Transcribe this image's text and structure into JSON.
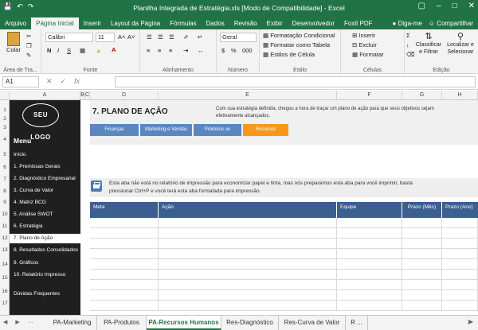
{
  "window": {
    "title": "Planilha Integrada de Estratégia.xls [Modo de Compatibilidade] - Excel",
    "qat_icons": [
      "save-icon",
      "undo-icon",
      "redo-icon"
    ]
  },
  "ribbon_tabs": [
    "Arquivo",
    "Página Inicial",
    "Inserir",
    "Layout da Página",
    "Fórmulas",
    "Dados",
    "Revisão",
    "Exibir",
    "Desenvolvedor",
    "Foxit PDF"
  ],
  "ribbon_right": {
    "tell_me": "Diga-me",
    "share": "Compartilhar"
  },
  "ribbon": {
    "clipboard": {
      "paste": "Colar",
      "label": "Área de Tra..."
    },
    "font": {
      "name": "Calibri",
      "size": "11",
      "label": "Fonte"
    },
    "alignment": {
      "label": "Alinhamento"
    },
    "number": {
      "format": "Geral",
      "label": "Número"
    },
    "styles": {
      "conditional": "Formatação Condicional",
      "as_table": "Formatar como Tabela",
      "cell_styles": "Estilos de Célula",
      "label": "Estilo"
    },
    "cells": {
      "insert": "Inserir",
      "delete": "Excluir",
      "format": "Formatar",
      "label": "Células"
    },
    "editing": {
      "sort": "Classificar e Filtrar",
      "find": "Localizar e Selecionar",
      "label": "Edição"
    }
  },
  "formula_bar": {
    "name_box": "A1",
    "fx": "fx",
    "value": ""
  },
  "columns": [
    "A",
    "B",
    "C",
    "D",
    "E",
    "F",
    "G",
    "H"
  ],
  "rows": [
    "1",
    "2",
    "3",
    "4",
    "5",
    "6",
    "7",
    "8",
    "9",
    "10",
    "11",
    "12",
    "13",
    "14",
    "15",
    "16",
    "17"
  ],
  "sidebar": {
    "logo": "SEU LOGO",
    "menu_title": "Menu",
    "items": [
      "Início",
      "1. Premissas Gerais",
      "2. Diagnóstico Empresarial",
      "3. Curva de Valor",
      "4. Matriz BCG",
      "5. Análise SWOT",
      "6. Estratégia",
      "7. Plano de Ação",
      "8. Resultados Consolidados",
      "9. Gráficos",
      "10. Relatório Impresso",
      "Dúvidas Frequentes"
    ],
    "active_index": 7
  },
  "page": {
    "title": "7. PLANO DE AÇÃO",
    "description": "Com sua estratégia definida, chegou a hora de traçar um plano de ação para que seus objetivos sejam efetivamente alcançados.",
    "tabs": [
      "Finanças",
      "Marketing e Vendas",
      "Produtos ou",
      "Recursos"
    ],
    "active_tab": 3
  },
  "notice": {
    "line1": "Esta aba não está no relatório de impressão para economizar papel e tinta, mas nós preparamos esta aba para você imprimir, basta",
    "line2": "pressionar Ctrl+P e você terá esta aba formatada para impressão."
  },
  "table": {
    "headers": [
      "Meta",
      "Ação",
      "Equipe",
      "Prazo (Mês)",
      "Prazo (Ano)"
    ],
    "empty_rows": 9
  },
  "sheet_tabs": [
    "PA-Marketing",
    "PA-Produtos",
    "PA-Recursos Humanos",
    "Res-Diagnóstico",
    "Res-Curva de Valor",
    "R ..."
  ],
  "active_sheet": 2,
  "colors": {
    "excel_green": "#217346",
    "tab_blue": "#5b87c0",
    "tab_orange": "#f7981d",
    "table_header": "#3b5f8f",
    "sidebar_bg": "#1f1f1f"
  }
}
